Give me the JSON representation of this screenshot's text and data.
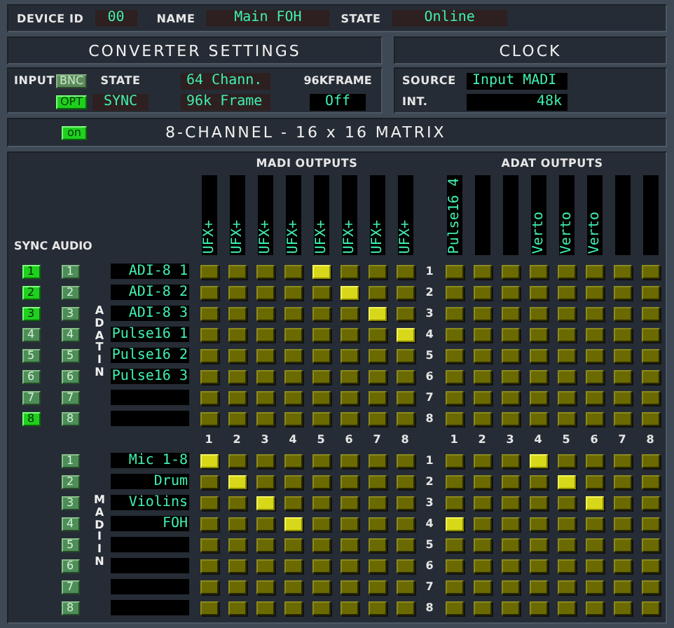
{
  "device": {
    "id_label": "DEVICE ID",
    "id": "00",
    "name_label": "NAME",
    "name": "Main FOH",
    "state_label": "STATE",
    "state": "Online"
  },
  "converter": {
    "title": "CONVERTER SETTINGS",
    "input_label": "INPUT",
    "inputs": [
      {
        "label": "BNC",
        "selected": false
      },
      {
        "label": "OPT",
        "selected": true
      }
    ],
    "state_label": "STATE",
    "state": "SYNC",
    "channels": "64 Chann.",
    "frame": "96k Frame",
    "frame96_label": "96KFRAME",
    "frame96": "Off"
  },
  "clock": {
    "title": "CLOCK",
    "source_label": "SOURCE",
    "source": "Input MADI",
    "int_label": "INT.",
    "int": "48k"
  },
  "matrix": {
    "toggle": {
      "label": "on",
      "on": true
    },
    "title": "8-CHANNEL - 16 x 16 MATRIX",
    "sync_header": "SYNC",
    "audio_header": "AUDIO",
    "madi_title": "MADI OUTPUTS",
    "adat_title": "ADAT OUTPUTS",
    "madi_outputs": [
      {
        "kind": "named",
        "label": "UFX+"
      },
      {
        "kind": "named",
        "label": "UFX+"
      },
      {
        "kind": "named",
        "label": "UFX+"
      },
      {
        "kind": "named",
        "label": "UFX+"
      },
      {
        "kind": "named",
        "label": "UFX+"
      },
      {
        "kind": "named",
        "label": "UFX+"
      },
      {
        "kind": "named",
        "label": "UFX+"
      },
      {
        "kind": "named",
        "label": "UFX+"
      }
    ],
    "adat_outputs": [
      {
        "kind": "named",
        "label": "Pulse16 4"
      },
      {
        "kind": "blank"
      },
      {
        "kind": "blank"
      },
      {
        "kind": "named",
        "label": "Verto"
      },
      {
        "kind": "named",
        "label": "Verto"
      },
      {
        "kind": "named",
        "label": "Verto"
      },
      {
        "kind": "blank"
      },
      {
        "kind": "blank"
      }
    ],
    "groups": [
      {
        "label": "ADAT IN",
        "rows": [
          {
            "sync": "1",
            "sync_on": true,
            "audio": "1",
            "name": "ADI-8 1",
            "index": "1",
            "madi": [
              false,
              false,
              false,
              false,
              true,
              false,
              false,
              false
            ],
            "adat": [
              false,
              false,
              false,
              false,
              false,
              false,
              false,
              false
            ]
          },
          {
            "sync": "2",
            "sync_on": true,
            "audio": "2",
            "name": "ADI-8 2",
            "index": "2",
            "madi": [
              false,
              false,
              false,
              false,
              false,
              true,
              false,
              false
            ],
            "adat": [
              false,
              false,
              false,
              false,
              false,
              false,
              false,
              false
            ]
          },
          {
            "sync": "3",
            "sync_on": true,
            "audio": "3",
            "name": "ADI-8 3",
            "index": "3",
            "madi": [
              false,
              false,
              false,
              false,
              false,
              false,
              true,
              false
            ],
            "adat": [
              false,
              false,
              false,
              false,
              false,
              false,
              false,
              false
            ]
          },
          {
            "sync": "4",
            "sync_on": false,
            "audio": "4",
            "name": "Pulse16 1",
            "index": "4",
            "madi": [
              false,
              false,
              false,
              false,
              false,
              false,
              false,
              true
            ],
            "adat": [
              false,
              false,
              false,
              false,
              false,
              false,
              false,
              false
            ]
          },
          {
            "sync": "5",
            "sync_on": false,
            "audio": "5",
            "name": "Pulse16 2",
            "index": "5",
            "madi": [
              false,
              false,
              false,
              false,
              false,
              false,
              false,
              false
            ],
            "adat": [
              false,
              false,
              false,
              false,
              false,
              false,
              false,
              false
            ]
          },
          {
            "sync": "6",
            "sync_on": false,
            "audio": "6",
            "name": "Pulse16 3",
            "index": "6",
            "madi": [
              false,
              false,
              false,
              false,
              false,
              false,
              false,
              false
            ],
            "adat": [
              false,
              false,
              false,
              false,
              false,
              false,
              false,
              false
            ]
          },
          {
            "sync": "7",
            "sync_on": false,
            "audio": "7",
            "index": "7",
            "madi": [
              false,
              false,
              false,
              false,
              false,
              false,
              false,
              false
            ],
            "adat": [
              false,
              false,
              false,
              false,
              false,
              false,
              false,
              false
            ]
          },
          {
            "sync": "8",
            "sync_on": true,
            "audio": "8",
            "index": "8",
            "madi": [
              false,
              false,
              false,
              false,
              false,
              false,
              false,
              false
            ],
            "adat": [
              false,
              false,
              false,
              false,
              false,
              false,
              false,
              false
            ]
          }
        ]
      },
      {
        "label": "MADI IN",
        "madi_numbers": [
          "1",
          "2",
          "3",
          "4",
          "5",
          "6",
          "7",
          "8"
        ],
        "adat_numbers": [
          "1",
          "2",
          "3",
          "4",
          "5",
          "6",
          "7",
          "8"
        ],
        "rows": [
          {
            "audio": "1",
            "name": "Mic 1-8",
            "index": "1",
            "madi": [
              true,
              false,
              false,
              false,
              false,
              false,
              false,
              false
            ],
            "adat": [
              false,
              false,
              false,
              true,
              false,
              false,
              false,
              false
            ]
          },
          {
            "audio": "2",
            "name": "Drum",
            "index": "2",
            "madi": [
              false,
              true,
              false,
              false,
              false,
              false,
              false,
              false
            ],
            "adat": [
              false,
              false,
              false,
              false,
              true,
              false,
              false,
              false
            ]
          },
          {
            "audio": "3",
            "name": "Violins",
            "index": "3",
            "madi": [
              false,
              false,
              true,
              false,
              false,
              false,
              false,
              false
            ],
            "adat": [
              false,
              false,
              false,
              false,
              false,
              true,
              false,
              false
            ]
          },
          {
            "audio": "4",
            "name": "FOH",
            "index": "4",
            "madi": [
              false,
              false,
              false,
              true,
              false,
              false,
              false,
              false
            ],
            "adat": [
              true,
              false,
              false,
              false,
              false,
              false,
              false,
              false
            ]
          },
          {
            "audio": "5",
            "index": "5",
            "madi": [
              false,
              false,
              false,
              false,
              false,
              false,
              false,
              false
            ],
            "adat": [
              false,
              false,
              false,
              false,
              false,
              false,
              false,
              false
            ]
          },
          {
            "audio": "6",
            "index": "6",
            "madi": [
              false,
              false,
              false,
              false,
              false,
              false,
              false,
              false
            ],
            "adat": [
              false,
              false,
              false,
              false,
              false,
              false,
              false,
              false
            ]
          },
          {
            "audio": "7",
            "index": "7",
            "madi": [
              false,
              false,
              false,
              false,
              false,
              false,
              false,
              false
            ],
            "adat": [
              false,
              false,
              false,
              false,
              false,
              false,
              false,
              false
            ]
          },
          {
            "audio": "8",
            "index": "8",
            "madi": [
              false,
              false,
              false,
              false,
              false,
              false,
              false,
              false
            ],
            "adat": [
              false,
              false,
              false,
              false,
              false,
              false,
              false,
              false
            ]
          }
        ]
      }
    ]
  }
}
